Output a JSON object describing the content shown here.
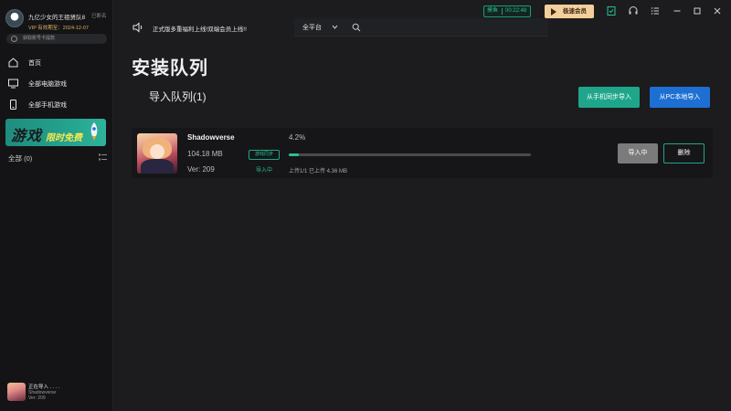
{
  "user": {
    "name": "九亿少女的王祖贤队8",
    "status": "已断名",
    "vip_text": "VIP 有效期至：2024-12-07",
    "account_button": "获取账号卡提款"
  },
  "sidebar": {
    "items": [
      {
        "label": "首页",
        "icon": "home-icon"
      },
      {
        "label": "全部电脑游戏",
        "icon": "monitor-icon"
      },
      {
        "label": "全部手机游戏",
        "icon": "phone-icon"
      }
    ],
    "banner": {
      "main_text": "游戏",
      "sub_text": "限时免费"
    },
    "all_label": "全部 (0)",
    "current_task": {
      "status": "正在导入 . . . .",
      "name": "Shadowverse",
      "version": "Ver: 209"
    }
  },
  "topbar": {
    "announcement": "正式版多重福利上线!双端会员上线!!",
    "platform": "全平台",
    "accelerator_label": "摸鱼",
    "accelerator_time": "00:22:48",
    "fast_member": "极速会员"
  },
  "main": {
    "page_title": "安装队列",
    "queue_title": "导入队列(1)",
    "sync_phone_button": "从手机同步导入",
    "pc_local_button": "从PC本地导入"
  },
  "task": {
    "name": "Shadowverse",
    "size": "104.18 MB",
    "version": "Ver: 209",
    "sync_tag": "游戏同步",
    "state_tag": "导入中",
    "percent_text": "4.2%",
    "progress": 0.042,
    "progress_text": "上传1/1 已上传 4.36 MB",
    "importing_button": "导入中",
    "delete_button": "删除"
  },
  "colors": {
    "accent_green": "#1fa68a",
    "accent_blue": "#1e6fd3",
    "gold": "#f2cf9c",
    "background": "#1c1c1e"
  }
}
